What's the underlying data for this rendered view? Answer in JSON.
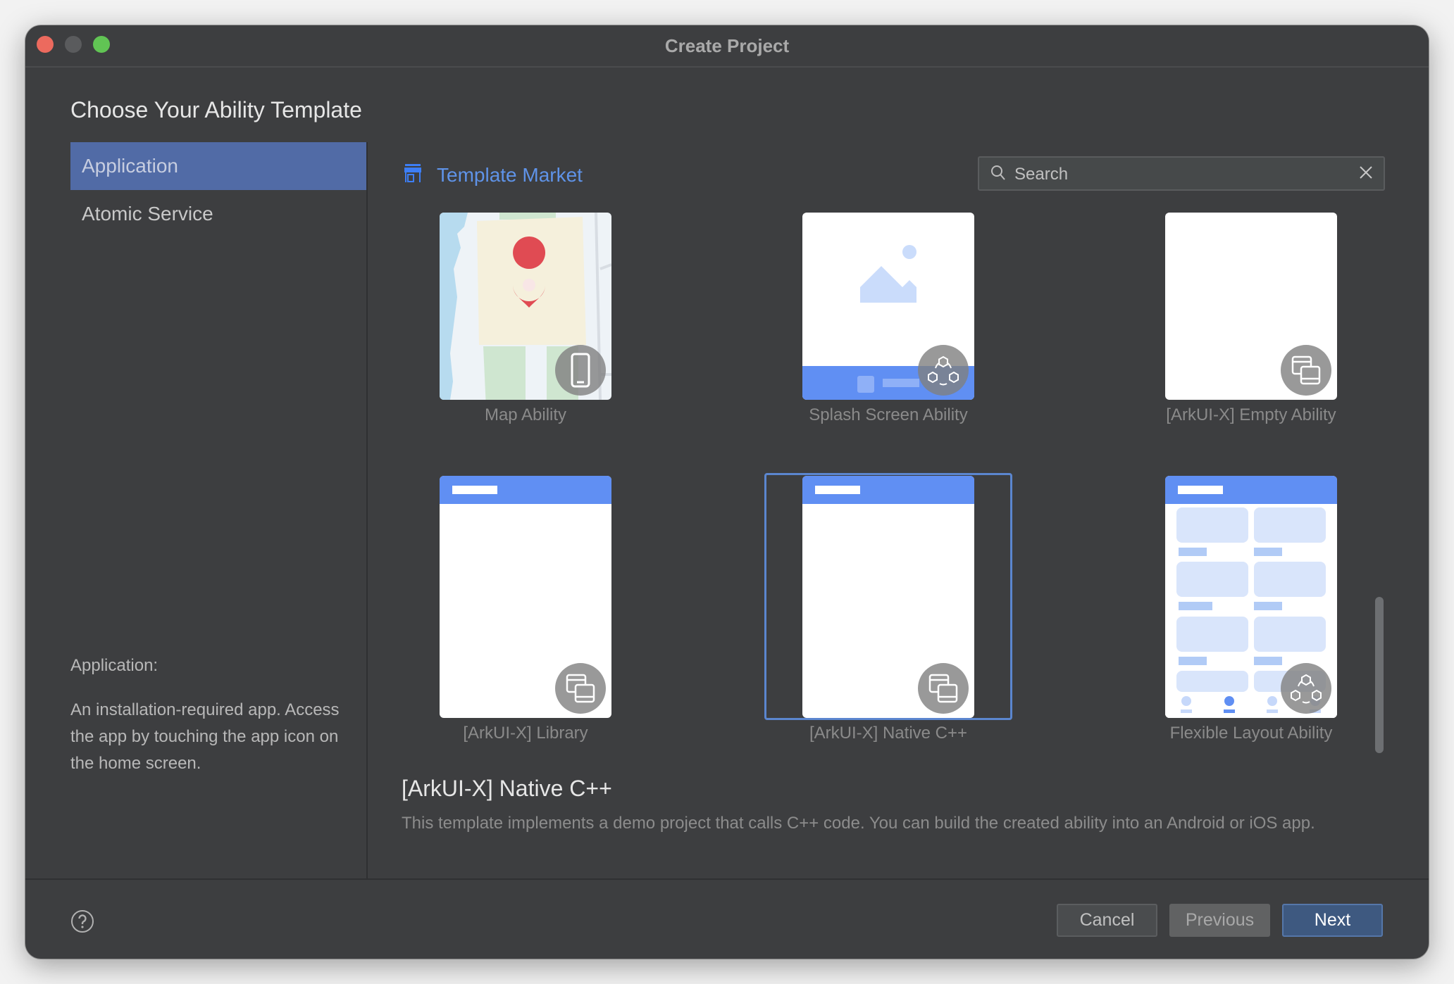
{
  "window": {
    "title": "Create Project"
  },
  "heading": "Choose Your Ability Template",
  "sidebar": {
    "items": [
      {
        "label": "Application",
        "active": true
      },
      {
        "label": "Atomic Service",
        "active": false
      }
    ],
    "description_title": "Application:",
    "description": "An installation-required app. Access the app by touching the app icon on the home screen."
  },
  "market": {
    "label": "Template Market",
    "icon": "store-icon"
  },
  "search": {
    "placeholder": "Search",
    "value": ""
  },
  "templates": [
    {
      "name": "Map Ability",
      "badge": "phone-icon",
      "selected": false
    },
    {
      "name": "Splash Screen Ability",
      "badge": "multi-device-icon",
      "selected": false
    },
    {
      "name": "[ArkUI-X] Empty Ability",
      "badge": "cross-platform-icon",
      "selected": false
    },
    {
      "name": "[ArkUI-X] Library",
      "badge": "cross-platform-icon",
      "selected": false
    },
    {
      "name": "[ArkUI-X] Native C++",
      "badge": "cross-platform-icon",
      "selected": true
    },
    {
      "name": "Flexible Layout Ability",
      "badge": "multi-device-icon",
      "selected": false
    }
  ],
  "detail": {
    "title": "[ArkUI-X] Native C++",
    "description": "This template implements a demo project that calls C++ code. You can build the created ability into an Android or iOS app."
  },
  "footer": {
    "cancel": "Cancel",
    "previous": "Previous",
    "next": "Next"
  },
  "colors": {
    "accent": "#608ff3",
    "selection": "#5b86cf",
    "primary_button": "#3e5980",
    "sidebar_active": "#516ba6"
  }
}
